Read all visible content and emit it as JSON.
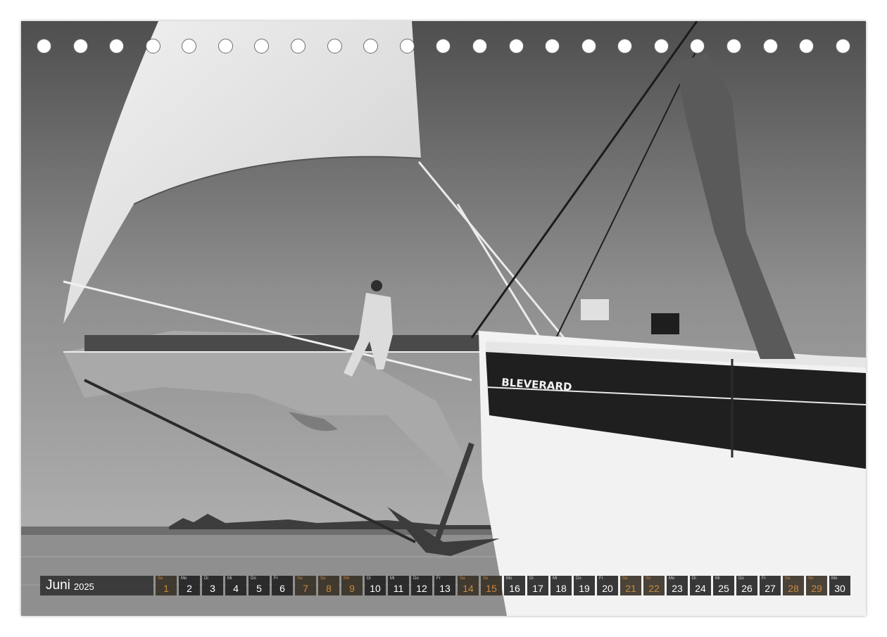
{
  "calendar": {
    "month": "Juni",
    "year": "2025",
    "days": [
      {
        "dow": "So",
        "num": "1",
        "weekend": true
      },
      {
        "dow": "Mo",
        "num": "2",
        "weekend": false
      },
      {
        "dow": "Di",
        "num": "3",
        "weekend": false
      },
      {
        "dow": "Mi",
        "num": "4",
        "weekend": false
      },
      {
        "dow": "Do",
        "num": "5",
        "weekend": false
      },
      {
        "dow": "Fr",
        "num": "6",
        "weekend": false
      },
      {
        "dow": "Sa",
        "num": "7",
        "weekend": true
      },
      {
        "dow": "So",
        "num": "8",
        "weekend": true
      },
      {
        "dow": "Mo",
        "num": "9",
        "weekend": true
      },
      {
        "dow": "Di",
        "num": "10",
        "weekend": false
      },
      {
        "dow": "Mi",
        "num": "11",
        "weekend": false
      },
      {
        "dow": "Do",
        "num": "12",
        "weekend": false
      },
      {
        "dow": "Fr",
        "num": "13",
        "weekend": false
      },
      {
        "dow": "Sa",
        "num": "14",
        "weekend": true
      },
      {
        "dow": "So",
        "num": "15",
        "weekend": true
      },
      {
        "dow": "Mo",
        "num": "16",
        "weekend": false
      },
      {
        "dow": "Di",
        "num": "17",
        "weekend": false
      },
      {
        "dow": "Mi",
        "num": "18",
        "weekend": false
      },
      {
        "dow": "Do",
        "num": "19",
        "weekend": false
      },
      {
        "dow": "Fr",
        "num": "20",
        "weekend": false
      },
      {
        "dow": "Sa",
        "num": "21",
        "weekend": true
      },
      {
        "dow": "So",
        "num": "22",
        "weekend": true
      },
      {
        "dow": "Mo",
        "num": "23",
        "weekend": false
      },
      {
        "dow": "Di",
        "num": "24",
        "weekend": false
      },
      {
        "dow": "Mi",
        "num": "25",
        "weekend": false
      },
      {
        "dow": "Do",
        "num": "26",
        "weekend": false
      },
      {
        "dow": "Fr",
        "num": "27",
        "weekend": false
      },
      {
        "dow": "Sa",
        "num": "28",
        "weekend": true
      },
      {
        "dow": "So",
        "num": "29",
        "weekend": true
      },
      {
        "dow": "Mo",
        "num": "30",
        "weekend": false
      }
    ]
  },
  "binding": {
    "hole_count": 23
  },
  "photo": {
    "hull_lettering": "BLEVERARD"
  },
  "colors": {
    "weekend": "#c98a3e",
    "cell": "#1e1e1e",
    "hole": "#ffffff"
  }
}
